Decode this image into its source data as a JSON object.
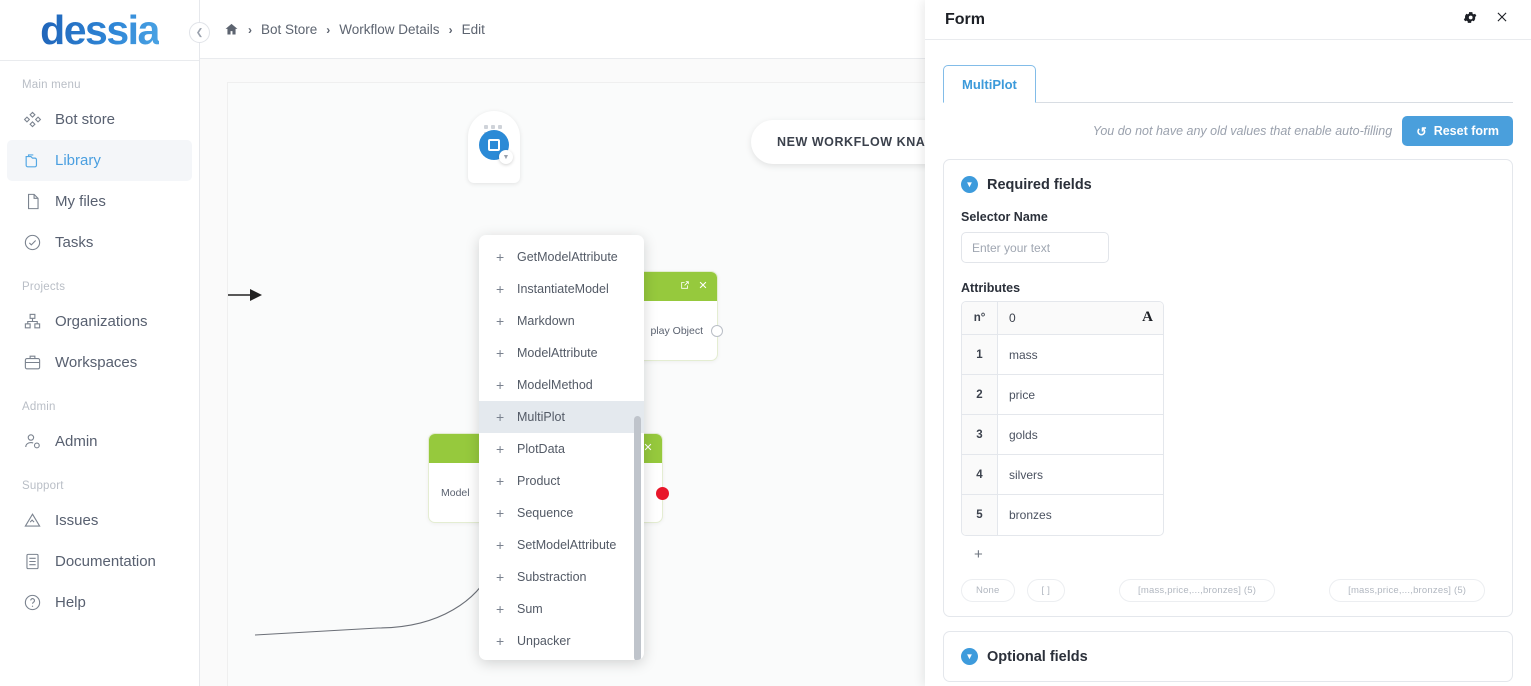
{
  "brand": {
    "logo": "dessia"
  },
  "sidebar": {
    "groups": [
      {
        "label": "Main menu",
        "items": [
          {
            "label": "Bot store",
            "icon": "bot-store-icon",
            "active": false
          },
          {
            "label": "Library",
            "icon": "library-icon",
            "active": true
          },
          {
            "label": "My files",
            "icon": "file-icon",
            "active": false
          },
          {
            "label": "Tasks",
            "icon": "tasks-icon",
            "active": false
          }
        ]
      },
      {
        "label": "Projects",
        "items": [
          {
            "label": "Organizations",
            "icon": "organizations-icon",
            "active": false
          },
          {
            "label": "Workspaces",
            "icon": "workspaces-icon",
            "active": false
          }
        ]
      },
      {
        "label": "Admin",
        "items": [
          {
            "label": "Admin",
            "icon": "admin-user-icon",
            "active": false
          }
        ]
      },
      {
        "label": "Support",
        "items": [
          {
            "label": "Issues",
            "icon": "issues-icon",
            "active": false
          },
          {
            "label": "Documentation",
            "icon": "documentation-icon",
            "active": false
          },
          {
            "label": "Help",
            "icon": "help-icon",
            "active": false
          }
        ]
      }
    ],
    "collapse_icon": "chevron-left-icon"
  },
  "breadcrumb": {
    "home_icon": "home-icon",
    "separator": "›",
    "items": [
      "Bot Store",
      "Workflow Details",
      "Edit"
    ]
  },
  "canvas": {
    "workflow_title": "NEW WORKFLOW KNAPSACK",
    "add_node": {
      "grid_icon": "grid-dots-icon",
      "block_icon": "square-block-icon",
      "caret_icon": "chevron-down-icon"
    },
    "nodes": [
      {
        "title": "",
        "port_label": "play Object",
        "edit_icon": "edit-icon",
        "close_icon": "close-icon"
      },
      {
        "title": "",
        "port_label": "Model",
        "close_icon": "close-icon"
      }
    ]
  },
  "dropdown": {
    "highlighted": "MultiPlot",
    "items": [
      "GetModelAttribute",
      "InstantiateModel",
      "Markdown",
      "ModelAttribute",
      "ModelMethod",
      "MultiPlot",
      "PlotData",
      "Product",
      "Sequence",
      "SetModelAttribute",
      "Substraction",
      "Sum",
      "Unpacker"
    ],
    "plus": "+"
  },
  "panel": {
    "title": "Form",
    "gear_icon": "gear-icon",
    "close_icon": "close-icon",
    "tabs": [
      {
        "label": "MultiPlot",
        "active": true
      }
    ],
    "autofill_text": "You do not have any old values that enable auto-filling",
    "reset_button": {
      "label": "Reset form",
      "icon": "reset-icon"
    },
    "required_section": {
      "title": "Required fields",
      "chevron_icon": "chevron-down-circle-icon",
      "selector_name_label": "Selector Name",
      "selector_name_value": "",
      "selector_name_placeholder": "Enter your text",
      "attributes_label": "Attributes",
      "table": {
        "headers": {
          "index": "n°",
          "value": "0",
          "sort_glyph": "A"
        },
        "rows": [
          {
            "n": "1",
            "value": "mass"
          },
          {
            "n": "2",
            "value": "price"
          },
          {
            "n": "3",
            "value": "golds"
          },
          {
            "n": "4",
            "value": "silvers"
          },
          {
            "n": "5",
            "value": "bronzes"
          }
        ]
      },
      "add_row": "+",
      "chips": [
        "None",
        "[ ]",
        "[mass,price,...,bronzes] (5)",
        "[mass,price,...,bronzes] (5)"
      ]
    },
    "optional_section": {
      "title": "Optional fields",
      "chevron_icon": "chevron-down-circle-icon"
    }
  },
  "colors": {
    "brand_blue": "#2f7fd1",
    "accent_blue": "#4a9fdc",
    "node_green": "#96c93d",
    "port_red": "#e8172a"
  }
}
